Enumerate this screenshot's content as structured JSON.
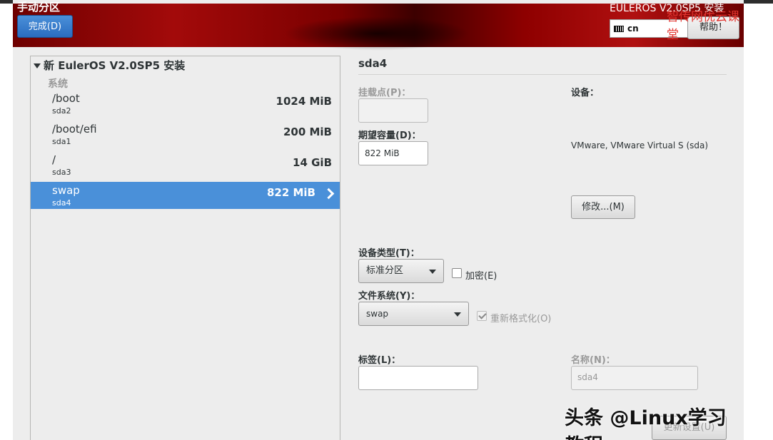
{
  "header": {
    "spoke_title": "手动分区",
    "done_button": "完成(D)",
    "product_title": "EULEROS V2.0SP5 安装",
    "watermark": "智传网优云课堂",
    "keyboard_layout": "cn",
    "help_button": "帮助！"
  },
  "partitions": {
    "root_label": "新 EulerOS V2.0SP5 安装",
    "group_label": "系统",
    "items": [
      {
        "mount": "/boot",
        "device": "sda2",
        "size": "1024 MiB"
      },
      {
        "mount": "/boot/efi",
        "device": "sda1",
        "size": "200 MiB"
      },
      {
        "mount": "/",
        "device": "sda3",
        "size": "14 GiB"
      },
      {
        "mount": "swap",
        "device": "sda4",
        "size": "822 MiB",
        "selected": true
      }
    ]
  },
  "details": {
    "title": "sda4",
    "mount_point_label": "挂载点(P)：",
    "mount_point_value": "",
    "capacity_label": "期望容量(D)：",
    "capacity_value": "822 MiB",
    "device_label": "设备：",
    "device_value": "VMware, VMware Virtual S (sda)",
    "modify_button": "修改...(M)",
    "device_type_label": "设备类型(T)：",
    "device_type_value": "标准分区",
    "encrypt_label": "加密(E)",
    "filesystem_label": "文件系统(Y)：",
    "filesystem_value": "swap",
    "reformat_label": "重新格式化(O)",
    "tag_label": "标签(L)：",
    "tag_value": "",
    "name_label": "名称(N)：",
    "name_value": "sda4",
    "update_button": "更新设置(U)"
  },
  "overlay_watermark": "头条 @Linux学习教程",
  "colors": {
    "header_red": "#8e0000",
    "selection_blue": "#4a90d9",
    "done_blue": "#3a80cf"
  }
}
